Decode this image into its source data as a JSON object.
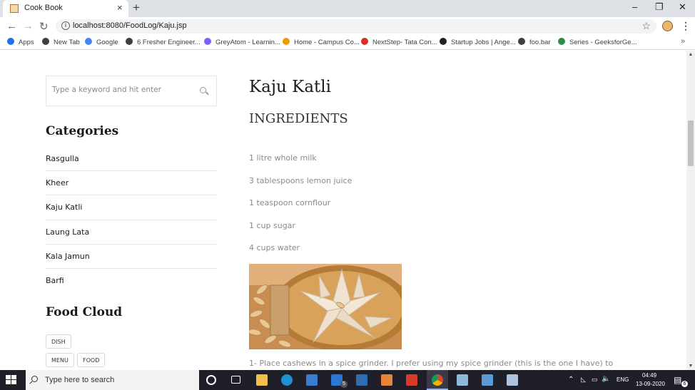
{
  "browser": {
    "tab_title": "Cook Book",
    "tab_close": "×",
    "new_tab": "+",
    "url": "localhost:8080/FoodLog/Kaju.jsp",
    "window_controls": {
      "minimize": "–",
      "restore": "❐",
      "close": "✕"
    },
    "bookmarks": [
      {
        "label": "Apps",
        "color": "#1a73e8"
      },
      {
        "label": "New Tab",
        "color": "#3c4043"
      },
      {
        "label": "Google",
        "color": "#4285f4"
      },
      {
        "label": "6 Fresher Engineer...",
        "color": "#3c4043"
      },
      {
        "label": "GreyAtom - Learnin...",
        "color": "#7b61ff"
      },
      {
        "label": "Home - Campus Co...",
        "color": "#f29900"
      },
      {
        "label": "NextStep- Tata Con...",
        "color": "#d93025"
      },
      {
        "label": "Startup Jobs | Ange...",
        "color": "#202124"
      },
      {
        "label": "foo.bar",
        "color": "#3c4043"
      },
      {
        "label": "Series - GeeksforGe...",
        "color": "#2f8d46"
      }
    ],
    "bookmarks_more": "»"
  },
  "sidebar": {
    "search_placeholder": "Type a keyword and hit enter",
    "categories_heading": "Categories",
    "categories": [
      "Rasgulla",
      "Kheer",
      "Kaju Katli",
      "Laung Lata",
      "Kala Jamun",
      "Barfi"
    ],
    "food_cloud_heading": "Food Cloud",
    "tags": [
      "DISH",
      "MENU",
      "FOOD"
    ]
  },
  "recipe": {
    "title": "Kaju Katli",
    "ingredients_heading": "INGREDIENTS",
    "ingredients": [
      "1 litre whole milk",
      "3 tablespoons lemon juice",
      "1 teaspoon cornflour",
      "1 cup sugar",
      "4 cups water"
    ],
    "image_subject": "kaju katli sweets with cashews",
    "step_1": "1- Place cashews in a spice grinder. I prefer using my spice grinder (this is the one I have) to"
  },
  "taskbar": {
    "search_placeholder": "Type here to search",
    "mail_badge": "5",
    "language": "ENG",
    "time": "04:49",
    "date": "13-09-2020",
    "notification_count": "6"
  }
}
